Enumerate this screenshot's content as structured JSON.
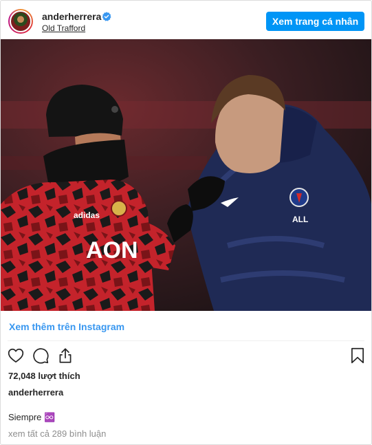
{
  "post": {
    "username": "anderherrera",
    "location": "Old Trafford",
    "view_profile_label": "Xem trang cá nhân",
    "more_on_instagram": "Xem thêm trên Instagram",
    "likes": "72,048 lượt thích",
    "caption_username": "anderherrera",
    "caption_text": "Siempre ♾️",
    "view_comments": "xem tất cả 289 bình luận"
  },
  "icons": {
    "verified": "verified-badge-icon",
    "like": "heart-icon",
    "comment": "comment-bubble-icon",
    "share": "share-upload-icon",
    "save": "bookmark-icon"
  },
  "colors": {
    "accent": "#0095f6",
    "link": "#3897f0",
    "muted": "#8e8e8e"
  }
}
